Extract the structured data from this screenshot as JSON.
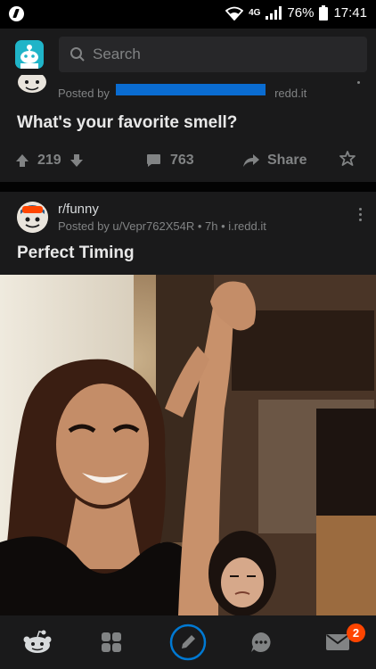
{
  "status_bar": {
    "battery": "76%",
    "time": "17:41",
    "network": "4G"
  },
  "header": {
    "search_placeholder": "Search",
    "logo_icon": "reddit-snoo-icon"
  },
  "post_partial": {
    "meta_prefix": "Posted by",
    "meta_suffix": "redd.it",
    "title": "What's your favorite smell?",
    "upvotes": "219",
    "comments": "763",
    "share_label": "Share"
  },
  "post_main": {
    "subreddit": "r/funny",
    "posted_by": "Posted by u/Vepr762X54R • 7h • i.redd.it",
    "title": "Perfect Timing"
  },
  "bottom_nav": {
    "inbox_badge": "2"
  },
  "colors": {
    "background": "#1a1a1b",
    "accent": "#0079d3",
    "badge": "#ff4500",
    "muted_text": "#818384"
  }
}
